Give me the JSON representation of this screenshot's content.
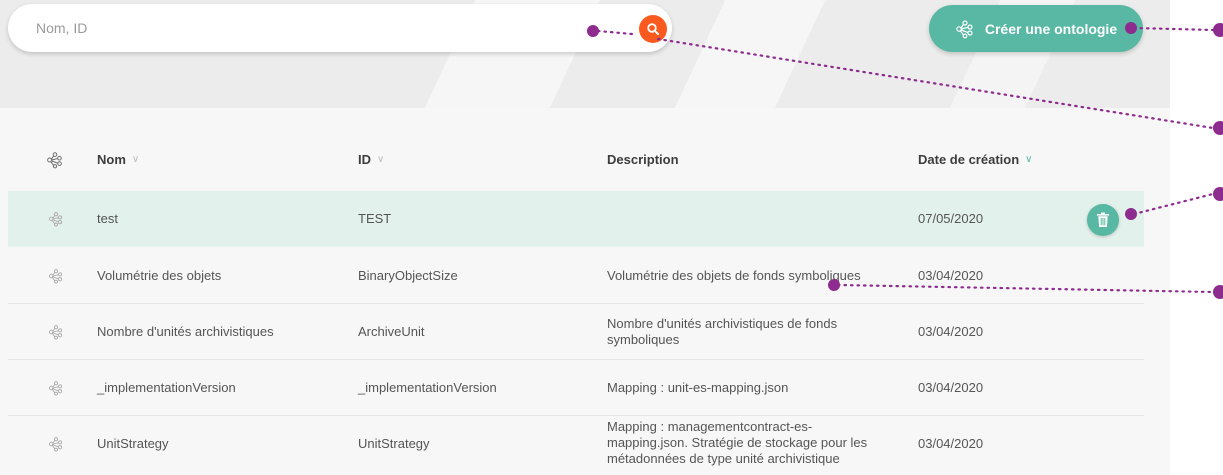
{
  "search": {
    "placeholder": "Nom, ID",
    "icon": "search-icon"
  },
  "toolbar": {
    "create_label": "Créer une ontologie",
    "create_icon": "ontology-icon"
  },
  "table": {
    "columns": [
      {
        "label": "Nom",
        "sortable": true
      },
      {
        "label": "ID",
        "sortable": true
      },
      {
        "label": "Description",
        "sortable": false
      },
      {
        "label": "Date de création",
        "sortable": true,
        "active": true
      }
    ],
    "rows": [
      {
        "nom": "test",
        "id": "TEST",
        "description": "",
        "date": "07/05/2020"
      },
      {
        "nom": "Volumétrie des objets",
        "id": "BinaryObjectSize",
        "description": "Volumétrie des objets de fonds symboliques",
        "date": "03/04/2020"
      },
      {
        "nom": "Nombre d'unités archivistiques",
        "id": "ArchiveUnit",
        "description": "Nombre d'unités archivistiques de fonds symboliques",
        "date": "03/04/2020"
      },
      {
        "nom": "_implementationVersion",
        "id": "_implementationVersion",
        "description": "Mapping : unit-es-mapping.json",
        "date": "03/04/2020"
      },
      {
        "nom": "UnitStrategy",
        "id": "UnitStrategy",
        "description": "Mapping : managementcontract-es-mapping.json. Stratégie de stockage pour les métadonnées de type unité archivistique",
        "date": "03/04/2020"
      }
    ]
  },
  "colors": {
    "accent": "#58b8a3",
    "search_button": "#fb5a1f",
    "annotation": "#8e2b8e",
    "highlight_row": "#e3f1ec"
  }
}
